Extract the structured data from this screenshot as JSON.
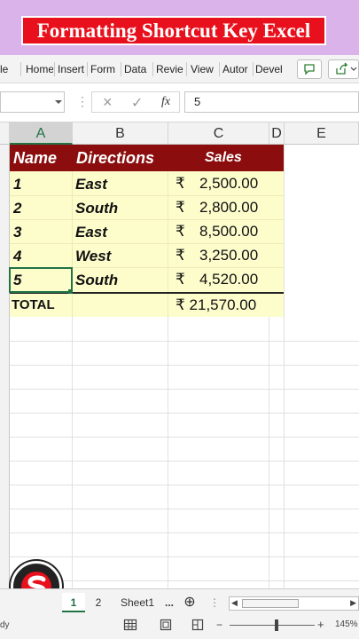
{
  "banner": {
    "title": "Formatting Shortcut Key Excel"
  },
  "ribbon": {
    "tabs": [
      "le",
      "Home",
      "Insert",
      "Form",
      "Data",
      "Revie",
      "View",
      "Autor",
      "Devel"
    ]
  },
  "formula_bar": {
    "fx_label": "fx",
    "cancel_icon": "×",
    "enter_icon": "✓",
    "dots": "⋮",
    "value": "5"
  },
  "columns": [
    "A",
    "B",
    "C",
    "D",
    "E"
  ],
  "table": {
    "headers": {
      "name": "Name",
      "directions": "Directions",
      "sales": "Sales"
    },
    "rows": [
      {
        "name": "1",
        "direction": "East",
        "currency": "₹",
        "amount": "2,500.00"
      },
      {
        "name": "2",
        "direction": "South",
        "currency": "₹",
        "amount": "2,800.00"
      },
      {
        "name": "3",
        "direction": "East",
        "currency": "₹",
        "amount": "8,500.00"
      },
      {
        "name": "4",
        "direction": "West",
        "currency": "₹",
        "amount": "3,250.00"
      },
      {
        "name": "5",
        "direction": "South",
        "currency": "₹",
        "amount": "4,520.00"
      }
    ],
    "total_label": "TOTAL",
    "total_value": "₹ 21,570.00"
  },
  "status": {
    "left_text": "dy",
    "sheet_tabs": [
      "1",
      "2",
      "Sheet1"
    ],
    "more": "...",
    "add_sheet": "⊕",
    "zoom": "145%",
    "minus": "−",
    "plus": "+"
  },
  "colors": {
    "banner_bg": "#d9b3ea",
    "title_red": "#e8101c",
    "header_maroon": "#8b0d0d",
    "cell_yellow": "#fdfdcc"
  }
}
